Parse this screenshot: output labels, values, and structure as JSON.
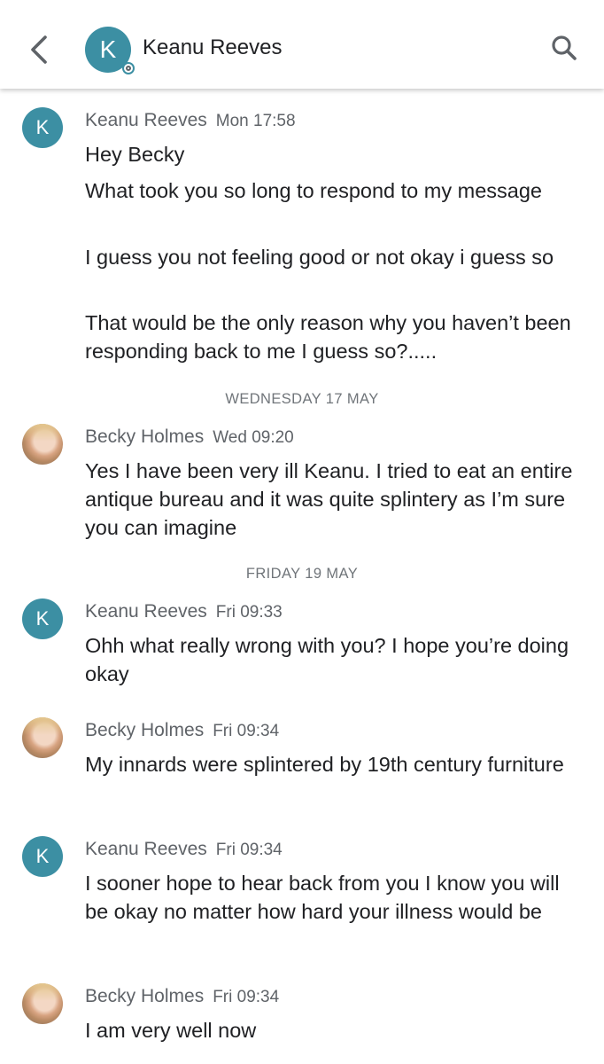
{
  "header": {
    "title": "Keanu Reeves",
    "avatar_letter": "K"
  },
  "dividers": [
    "WEDNESDAY 17 MAY",
    "FRIDAY 19 MAY"
  ],
  "messages": [
    {
      "sender": "Keanu Reeves",
      "time": "Mon 17:58",
      "avatar_letter": "K",
      "lines": [
        "Hey Becky",
        "What took you so long to respond to my message",
        "I guess you not feeling good or not okay i guess so",
        "That would be the only reason why you haven’t been responding back to me I guess so?....."
      ]
    },
    {
      "sender": "Becky Holmes",
      "time": "Wed 09:20",
      "lines": [
        "Yes I have been very ill Keanu. I tried to eat an entire antique bureau and it was quite splintery as I’m sure you can imagine"
      ]
    },
    {
      "sender": "Keanu Reeves",
      "time": "Fri 09:33",
      "avatar_letter": "K",
      "lines": [
        "Ohh what really wrong with you? I hope you’re doing okay"
      ]
    },
    {
      "sender": "Becky Holmes",
      "time": "Fri 09:34",
      "lines": [
        "My innards were splintered by 19th century furniture"
      ]
    },
    {
      "sender": "Keanu Reeves",
      "time": "Fri 09:34",
      "avatar_letter": "K",
      "lines": [
        "I sooner hope to hear back from you I know you will be okay no matter how hard your illness would be"
      ]
    },
    {
      "sender": "Becky Holmes",
      "time": "Fri 09:34",
      "lines": [
        "I am very well now"
      ]
    }
  ],
  "colors": {
    "accent_avatar": "#3c8fa3",
    "text_primary": "#202124",
    "text_secondary": "#5f6368"
  }
}
